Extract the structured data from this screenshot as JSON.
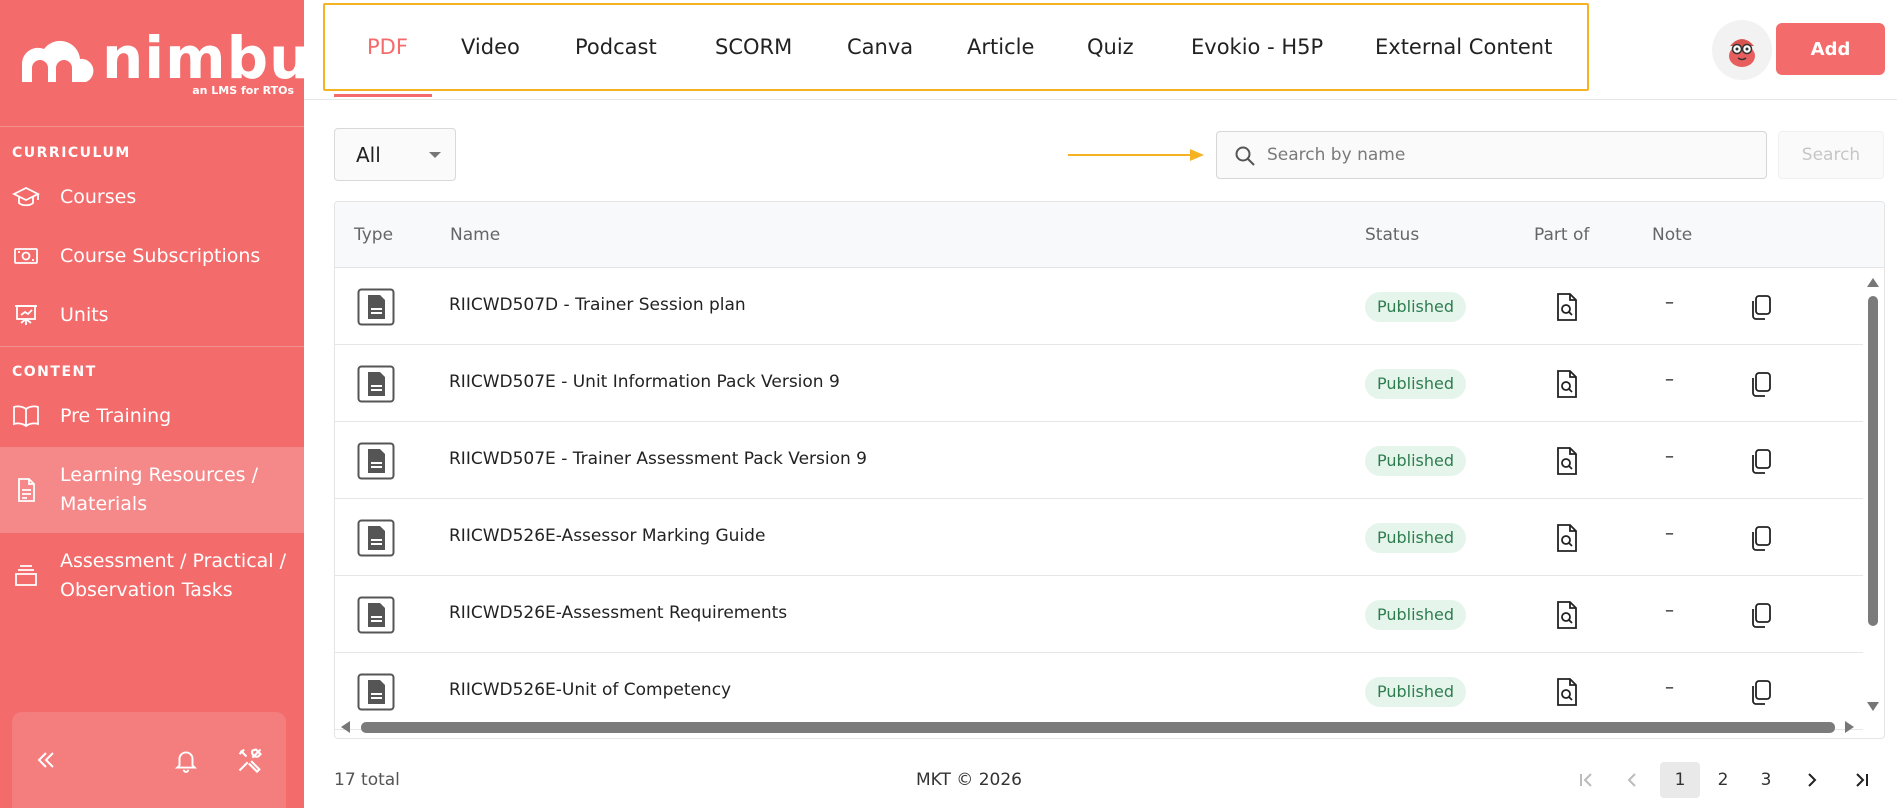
{
  "brand": {
    "name": "nimbu",
    "tagline": "an LMS for RTOs",
    "accent": "#f36b6b"
  },
  "sidebar": {
    "sections": [
      {
        "title": "CURRICULUM"
      },
      {
        "title": "CONTENT"
      }
    ],
    "items": [
      {
        "label": "Courses",
        "icon": "graduation-cap-icon"
      },
      {
        "label": "Course Subscriptions",
        "icon": "money-icon"
      },
      {
        "label": "Units",
        "icon": "presentation-board-icon"
      },
      {
        "label": "Pre Training",
        "icon": "book-icon"
      },
      {
        "label": "Learning Resources / Materials",
        "icon": "document-icon",
        "active": true
      },
      {
        "label": "Assessment / Practical / Observation Tasks",
        "icon": "stack-icon"
      }
    ]
  },
  "tabs": [
    "PDF",
    "Video",
    "Podcast",
    "SCORM",
    "Canva",
    "Article",
    "Quiz",
    "Evokio - H5P",
    "External Content"
  ],
  "active_tab": "PDF",
  "header": {
    "add_label": "Add"
  },
  "filter": {
    "selected": "All"
  },
  "search": {
    "placeholder": "Search by name",
    "value": "",
    "button_label": "Search"
  },
  "table": {
    "columns": [
      "Type",
      "Name",
      "Status",
      "Part of",
      "Note"
    ],
    "rows": [
      {
        "name": "RIICWD507D - Trainer Session plan",
        "status": "Published",
        "note": "–"
      },
      {
        "name": "RIICWD507E - Unit Information Pack Version 9",
        "status": "Published",
        "note": "–"
      },
      {
        "name": "RIICWD507E - Trainer Assessment Pack Version 9",
        "status": "Published",
        "note": "–"
      },
      {
        "name": "RIICWD526E-Assessor Marking Guide",
        "status": "Published",
        "note": "–"
      },
      {
        "name": "RIICWD526E-Assessment Requirements",
        "status": "Published",
        "note": "–"
      },
      {
        "name": "RIICWD526E-Unit of Competency",
        "status": "Published",
        "note": "–"
      }
    ]
  },
  "footer": {
    "total": "17 total",
    "copyright": "MKT © 2026",
    "pages": [
      "1",
      "2",
      "3"
    ],
    "current_page": "1"
  }
}
